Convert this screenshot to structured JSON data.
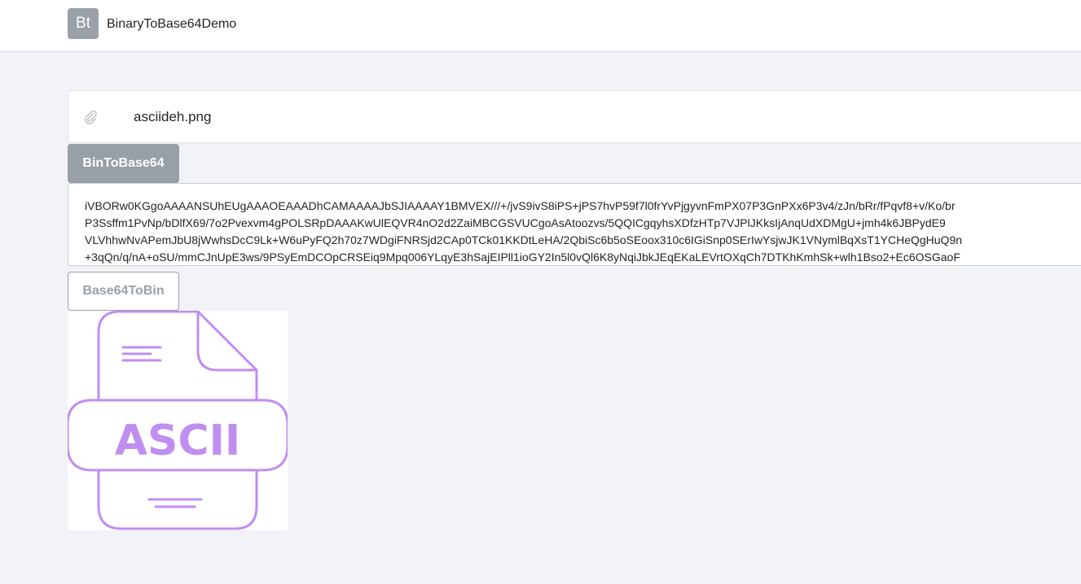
{
  "navbar": {
    "logo_text": "Bt",
    "app_title": "BinaryToBase64Demo"
  },
  "file_input": {
    "icon": "paperclip-icon",
    "file_name": "asciideh.png"
  },
  "actions": {
    "bin_to_base64_label": "BinToBase64",
    "base64_to_bin_label": "Base64ToBin"
  },
  "output": {
    "lines": [
      "iVBORw0KGgoAAAANSUhEUgAAAOEAAADhCAMAAAAJbSJIAAAAY1BMVEX///+/jvS9ivS8iPS+jPS7hvP59f7l0frYvPjgyvnFmPX07P3GnPXx6P3v4/zJn/bRr/fPqvf8+v/Ko/br",
      "P3Ssffm1PvNp/bDlfX69/7o2Pvexvm4gPOLSRpDAAAKwUlEQVR4nO2d2ZaiMBCGSVUCgoAsAtoozvs/5QQICgqyhsXDfzHTp7VJPlJKksIjAnqUdXDMgU+jmh4k6JBPydE9",
      "VLVhhwNvAPemJbU8jWwhsDcC9Lk+W6uPyFQ2h70z7WDgiFNRSjd2CAp0TCk01KKDtLeHA/2QbiSc6b5oSEoox310c6IGiSnp0SErIwYsjwJK1VNymlBqXsT1YCHeQgHuQ9n",
      "+3qQn/q/nA+oSU/mmCJnUpE3ws/9PSyEmDCOpCRSEiq9Mpq006YLqyE3hSajEIPll1ioGY2In5l0vQl6K8yNqiJbkJEqEKaLEVrtOXqCh7DTKhKmhSk+wlh1Bso2+Ec6OSGaoF"
    ]
  },
  "preview": {
    "label": "ASCII",
    "accent_color": "#c08ef0",
    "icon": "ascii-file-icon"
  }
}
